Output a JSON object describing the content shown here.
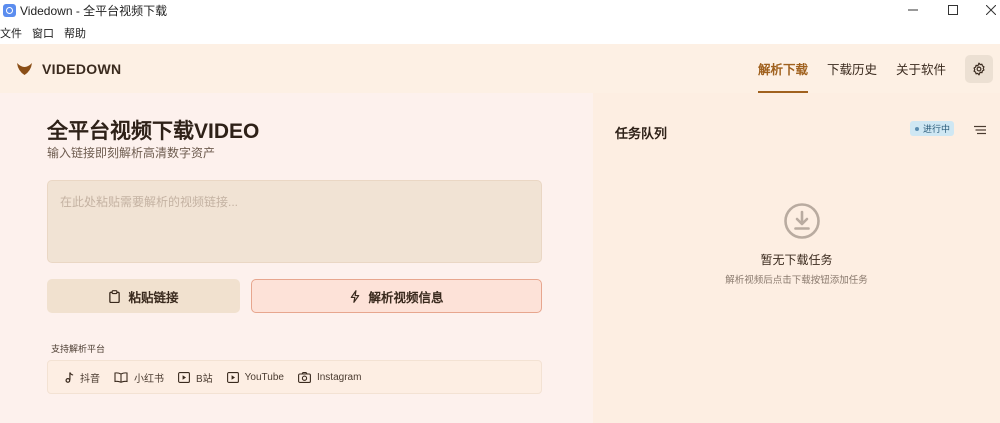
{
  "window": {
    "title": "Videdown - 全平台视频下载"
  },
  "menu": {
    "items": [
      "文件",
      "窗口",
      "帮助"
    ]
  },
  "header": {
    "brand": "VIDEDOWN",
    "nav": [
      "解析下载",
      "下载历史",
      "关于软件"
    ],
    "active_nav": "解析下载"
  },
  "main": {
    "title": "全平台视频下载VIDEO",
    "subtitle": "输入链接即刻解析高清数字资产",
    "url_input": {
      "value": "",
      "placeholder": "在此处粘贴需要解析的视频链接..."
    },
    "paste_button": "粘贴链接",
    "parse_button": "解析视频信息",
    "platforms_label": "支持解析平台",
    "platforms": [
      {
        "name": "抖音",
        "icon": "music-note-icon"
      },
      {
        "name": "小红书",
        "icon": "book-icon"
      },
      {
        "name": "B站",
        "icon": "play-box-icon"
      },
      {
        "name": "YouTube",
        "icon": "play-box-icon"
      },
      {
        "name": "Instagram",
        "icon": "camera-icon"
      }
    ]
  },
  "queue": {
    "title": "任务队列",
    "status_badge": "进行中",
    "empty_title": "暂无下载任务",
    "empty_desc": "解析视频后点击下载按钮添加任务"
  },
  "colors": {
    "accent": "#a0611e",
    "header_bg": "#fdf0e4",
    "left_bg": "#fdf1ed",
    "right_bg": "#fdeee2",
    "badge_bg": "#cfe7f3"
  }
}
